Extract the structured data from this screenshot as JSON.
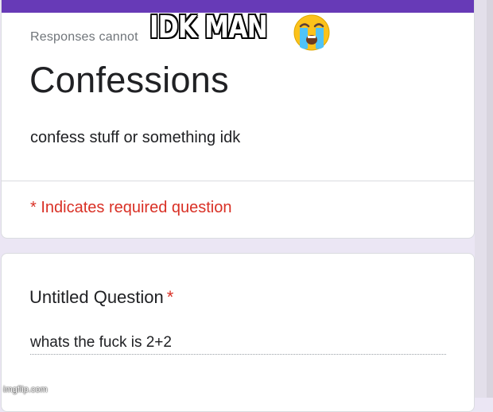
{
  "form": {
    "notice": "Responses cannot",
    "title": "Confessions",
    "description": "confess stuff or something idk",
    "required_note": "* Indicates required question",
    "accent_color": "#673ab7",
    "required_color": "#d93025"
  },
  "question": {
    "title": "Untitled Question",
    "required_marker": "*",
    "answer": "whats the fuck is 2+2"
  },
  "meme": {
    "caption": "IDK MAN",
    "emoji_icon": "loudly-crying-face-icon",
    "watermark": "imgflip.com"
  }
}
